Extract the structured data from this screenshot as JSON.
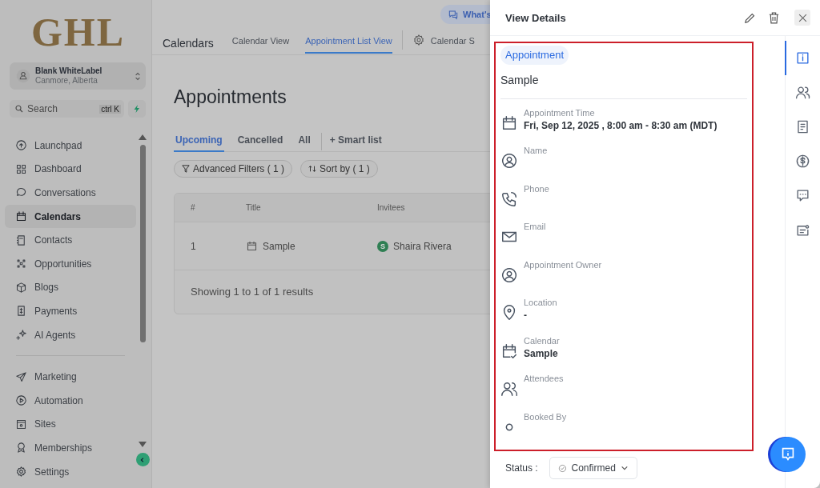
{
  "logo": "GHL",
  "account": {
    "name": "Blank WhiteLabel",
    "location": "Canmore, Alberta"
  },
  "search": {
    "placeholder": "Search",
    "shortcut": "ctrl K"
  },
  "nav": [
    {
      "kind": "launchpad",
      "label": "Launchpad",
      "selected": false
    },
    {
      "kind": "dashboard",
      "label": "Dashboard",
      "selected": false
    },
    {
      "kind": "chat",
      "label": "Conversations",
      "selected": false
    },
    {
      "kind": "calendar",
      "label": "Calendars",
      "selected": true
    },
    {
      "kind": "contacts",
      "label": "Contacts",
      "selected": false
    },
    {
      "kind": "opportunities",
      "label": "Opportunities",
      "selected": false
    },
    {
      "kind": "box",
      "label": "Blogs",
      "selected": false
    },
    {
      "kind": "payments",
      "label": "Payments",
      "selected": false
    },
    {
      "kind": "sparkle",
      "label": "AI Agents",
      "selected": false
    }
  ],
  "nav_bottom": [
    {
      "kind": "send",
      "label": "Marketing",
      "selected": false
    },
    {
      "kind": "automation",
      "label": "Automation",
      "selected": false
    },
    {
      "kind": "sites",
      "label": "Sites",
      "selected": false
    },
    {
      "kind": "badge",
      "label": "Memberships",
      "selected": false
    },
    {
      "kind": "gear",
      "label": "Settings",
      "selected": false
    }
  ],
  "header": {
    "title": "Calendars",
    "whats_new": "What's",
    "tabs": [
      {
        "label": "Calendar View",
        "selected": false
      },
      {
        "label": "Appointment List View",
        "selected": true
      }
    ],
    "settings_tab": "Calendar S"
  },
  "page_title": "Appointments",
  "list_tabs": [
    {
      "label": "Upcoming",
      "selected": true
    },
    {
      "label": "Cancelled",
      "selected": false
    },
    {
      "label": "All",
      "selected": false
    }
  ],
  "smart_list": "+ Smart list",
  "filters": [
    "Advanced Filters ( 1 )",
    "Sort by ( 1 )"
  ],
  "table": {
    "columns": [
      "#",
      "Title",
      "Invitees"
    ],
    "rows": [
      {
        "cells": [
          "1",
          "Sample",
          "Shaira Rivera"
        ],
        "avatar": "S"
      }
    ],
    "footer": "Showing 1 to 1 of 1 results"
  },
  "panel": {
    "title": "View Details",
    "tag": "Appointment",
    "name": "Sample",
    "fields": [
      {
        "kind": "calendar",
        "label": "Appointment Time",
        "value": "Fri, Sep 12, 2025 , 8:00 am - 8:30 am (MDT)"
      },
      {
        "kind": "user",
        "label": "Name"
      },
      {
        "kind": "phone",
        "label": "Phone"
      },
      {
        "kind": "mail",
        "label": "Email"
      },
      {
        "kind": "user",
        "label": "Appointment Owner"
      },
      {
        "kind": "pin",
        "label": "Location",
        "value": "-"
      },
      {
        "kind": "calendar-check",
        "label": "Calendar",
        "value": "Sample"
      },
      {
        "kind": "users",
        "label": "Attendees"
      },
      {
        "kind": "circle",
        "label": "Booked By"
      }
    ],
    "status_label": "Status :",
    "status": "Confirmed",
    "rail": [
      {
        "kind": "info",
        "selected": true
      },
      {
        "kind": "users",
        "selected": false
      },
      {
        "kind": "doc",
        "selected": false
      },
      {
        "kind": "dollar",
        "selected": false
      },
      {
        "kind": "message",
        "selected": false
      },
      {
        "kind": "note",
        "selected": false
      }
    ]
  }
}
